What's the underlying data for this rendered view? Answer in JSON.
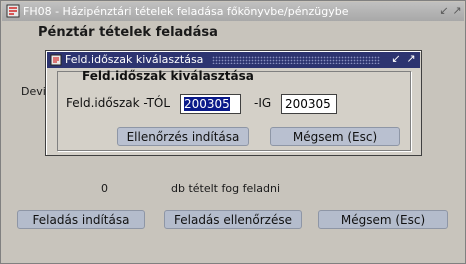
{
  "window": {
    "title": "FH08 - Házipénztári tételek feladása főkönyvbe/pénzügybe"
  },
  "main": {
    "panel_title": "Pénztár tételek feladása",
    "deviza_label_partial": "Devi",
    "count_value": "0",
    "count_text": "db tételt fog feladni",
    "buttons": {
      "post": "Feladás indítása",
      "check": "Feladás ellenőrzése",
      "cancel": "Mégsem (Esc)"
    }
  },
  "dialog": {
    "title": "Feld.időszak kiválasztása",
    "group_title": "Feld.időszak kiválasztása",
    "from_label": "Feld.időszak -TÓL",
    "from_value": "200305",
    "to_label": "-IG",
    "to_value": "200305",
    "check_button": "Ellenőrzés indítása",
    "cancel_button": "Mégsem (Esc)"
  },
  "icons": [
    "app-icon",
    "minimize-icon",
    "maximize-icon",
    "dialog-icon"
  ],
  "colors": {
    "dialog_titlebar": "#2d3470",
    "selection": "#0a1a8a",
    "button_face": "#b4bccc"
  }
}
